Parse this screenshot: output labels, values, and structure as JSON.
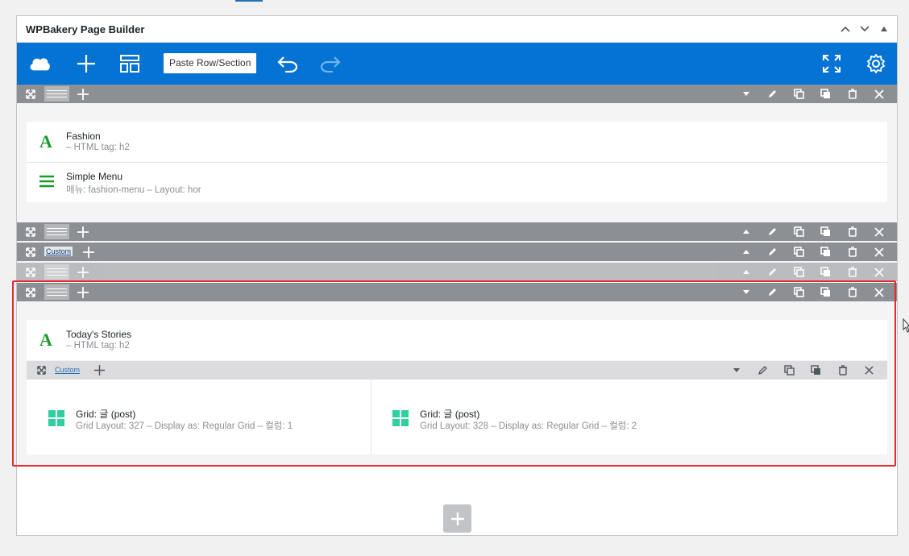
{
  "panel": {
    "title": "WPBakery Page Builder",
    "header_controls": [
      "chevron-up-icon",
      "chevron-down-icon",
      "triangle-up-icon"
    ]
  },
  "toolbar": {
    "paste_label": "Paste Row/Section",
    "icons": [
      "cloud-icon",
      "plus-icon",
      "layout-icon",
      "undo-icon",
      "redo-icon",
      "fullscreen-icon",
      "gear-icon"
    ],
    "background": "#0473d4"
  },
  "rows": {
    "row1": {
      "elements": [
        {
          "icon": "text-A-icon",
          "title": "Fashion",
          "sub": "– HTML tag: h2"
        },
        {
          "icon": "menu-icon",
          "title": "Simple Menu",
          "sub": "메뉴: fashion-menu – Layout: hor"
        }
      ]
    },
    "row3": {
      "custom": "Custom"
    },
    "row5": {
      "elements": [
        {
          "icon": "text-A-icon",
          "title": "Today's Stories",
          "sub": "– HTML tag: h2"
        }
      ],
      "inner_custom": "Custom",
      "columns": [
        {
          "title": "Grid: 글 (post)",
          "sub": "Grid Layout: 327 – Display as: Regular Grid – 컬럼: 1"
        },
        {
          "title": "Grid: 글 (post)",
          "sub": "Grid Layout: 328 – Display as: Regular Grid – 컬럼: 2"
        }
      ]
    }
  },
  "colors": {
    "accent_green": "#1a9a2c",
    "grid_teal": "#2fcfa0",
    "row_bar": "#8c8f94",
    "highlight_red": "#e32b33"
  }
}
